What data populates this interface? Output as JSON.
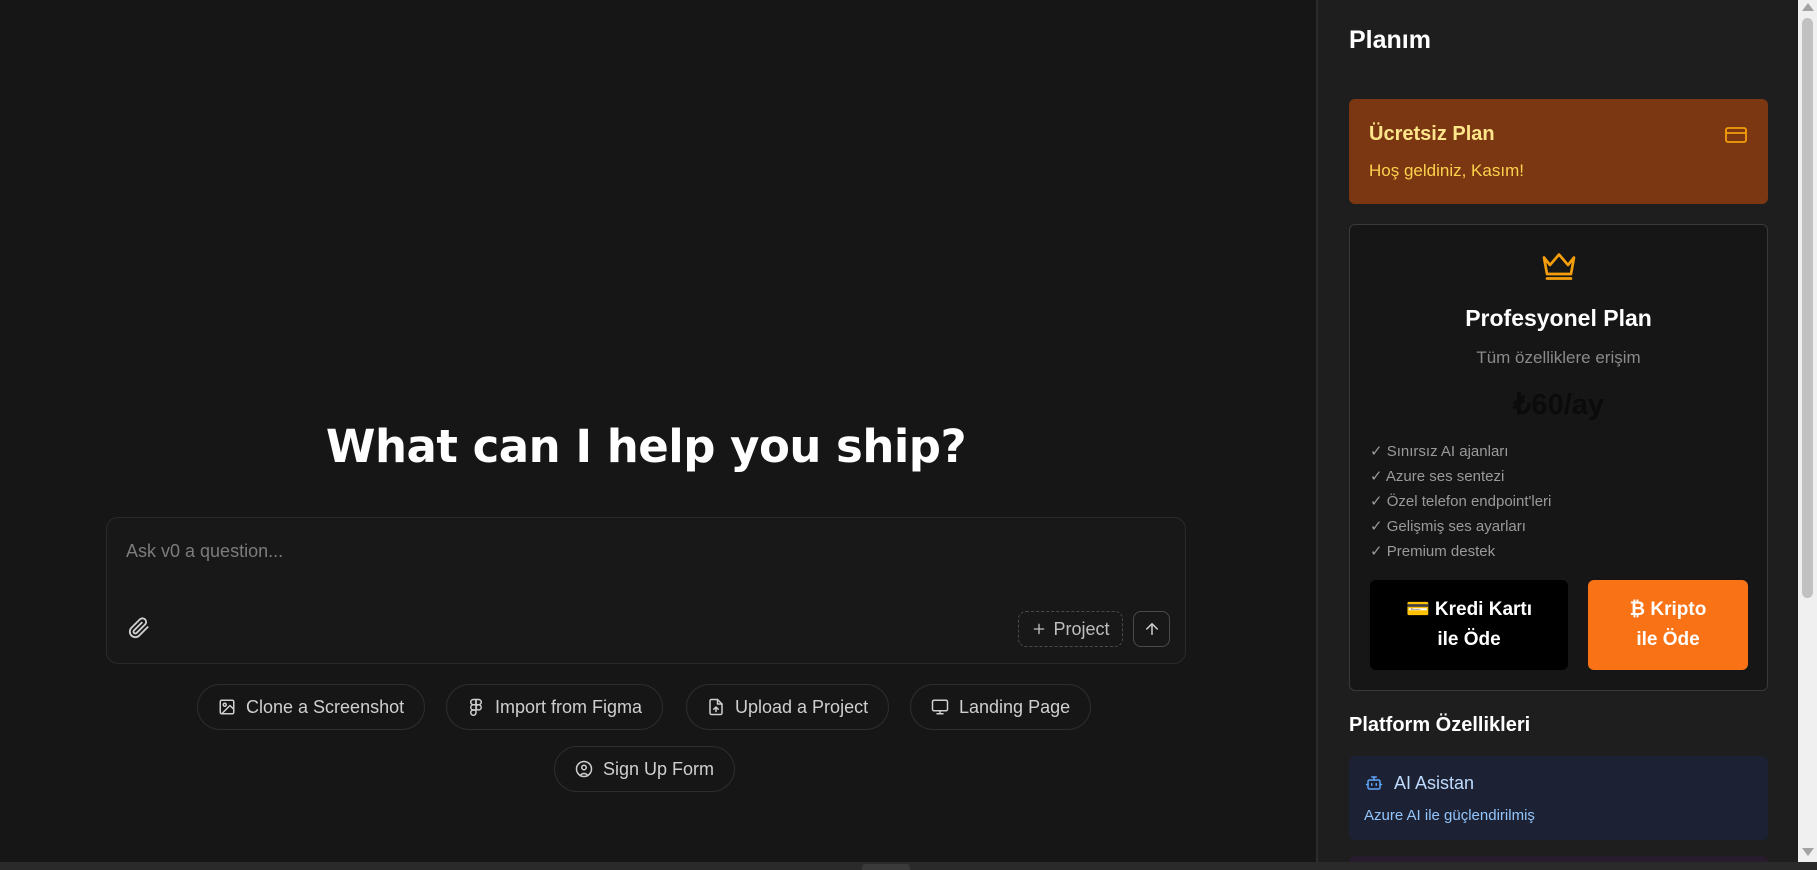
{
  "main": {
    "heading": "What can I help you ship?",
    "prompt": {
      "placeholder": "Ask v0 a question...",
      "project_label": "Project"
    },
    "suggestions": [
      {
        "label": "Clone a Screenshot",
        "icon": "image-icon"
      },
      {
        "label": "Import from Figma",
        "icon": "figma-icon"
      },
      {
        "label": "Upload a Project",
        "icon": "file-upload-icon"
      },
      {
        "label": "Landing Page",
        "icon": "monitor-icon"
      },
      {
        "label": "Sign Up Form",
        "icon": "user-circle-icon"
      }
    ]
  },
  "sidebar": {
    "title": "Planım",
    "free_plan": {
      "title": "Ücretsiz Plan",
      "welcome": "Hoş geldiniz, Kasım!",
      "icon": "credit-card-icon"
    },
    "pro_plan": {
      "icon": "crown-icon",
      "title": "Profesyonel Plan",
      "subtitle": "Tüm özelliklere erişim",
      "price": "₺60/ay",
      "features": [
        "✓ Sınırsız AI ajanları",
        "✓ Azure ses sentezi",
        "✓ Özel telefon endpoint'leri",
        "✓ Gelişmiş ses ayarları",
        "✓ Premium destek"
      ],
      "pay_card_line1": "💳 Kredi Kartı",
      "pay_card_line2": "ile Öde",
      "pay_crypto_line1": "₿ Kripto",
      "pay_crypto_line2": "ile Öde"
    },
    "platform": {
      "title": "Platform Özellikleri",
      "items": [
        {
          "name": "AI Asistan",
          "description": "Azure AI ile güçlendirilmiş",
          "icon": "bot-icon"
        }
      ]
    }
  },
  "colors": {
    "background": "#161616",
    "sidebar": "#1e1e1e",
    "free_card": "#7b3612",
    "free_text": "#fde68a",
    "crypto_button": "#f97316",
    "crown": "#f59e0b",
    "platform_card": "#1c2233",
    "platform_text": "#93c5fd"
  }
}
